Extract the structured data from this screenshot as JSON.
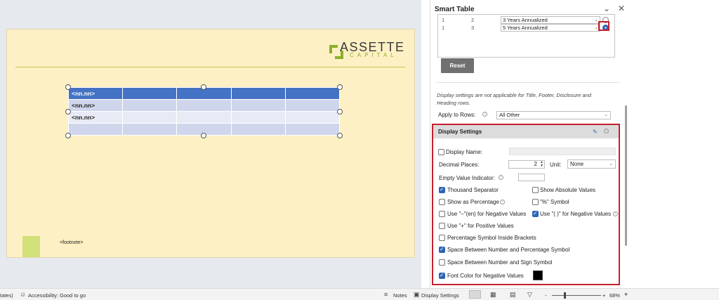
{
  "slide": {
    "logo_name": "ASSETTE",
    "logo_sub": "CAPITAL",
    "table_rows": [
      [
        "<nn.nn>",
        "",
        "",
        "",
        ""
      ],
      [
        "<nn.nn>",
        "",
        "",
        "",
        ""
      ],
      [
        "<nn.nn>",
        "",
        "",
        "",
        ""
      ],
      [
        "",
        "",
        "",
        "",
        ""
      ]
    ],
    "footnote": "<footnote>"
  },
  "pane": {
    "title": "Smart Table",
    "collapse_icon": "chevron-down-icon",
    "close_icon": "close-icon",
    "periods": [
      {
        "c1": "1",
        "c2": "2",
        "value": "3 Years Annualized",
        "selected": false
      },
      {
        "c1": "1",
        "c2": "3",
        "value": "5 Years Annualized",
        "selected": true
      }
    ],
    "reset_label": "Reset",
    "note": "Display settings are not applicable for Title, Footer, Disclosure and Heading rows.",
    "apply_label": "Apply to Rows:",
    "apply_value": "All Other"
  },
  "display_settings": {
    "title": "Display Settings",
    "display_name_label": "Display Name:",
    "decimal_label": "Decimal Places:",
    "decimal_value": "2",
    "unit_label": "Unit:",
    "unit_value": "None",
    "empty_label": "Empty Value Indicator:",
    "options": {
      "thousand_sep": "Thousand Separator",
      "show_absolute": "Show Absolute Values",
      "show_pct": "Show as Percentage",
      "pct_symbol": "\"%\" Symbol",
      "use_en": "Use \"–\"(en) for Negative Values",
      "use_paren": "Use \"( )\" for Negative Values",
      "use_plus": "Use \"+\" for Positive Values",
      "pct_brackets": "Percentage Symbol Inside Brackets",
      "space_pct": "Space Between Number and Percentage Symbol",
      "space_sign": "Space Between Number and Sign Symbol",
      "font_color_neg": "Font Color for Negative Values"
    },
    "negative_color": "#000000"
  },
  "statusbar": {
    "left_text": "tates)",
    "accessibility": "Accessibility: Good to go",
    "notes": "Notes",
    "display_settings": "Display Settings",
    "zoom_minus": "-",
    "zoom_plus": "+",
    "zoom": "68%"
  },
  "colors": {
    "accent_red": "#c5202f",
    "check_blue": "#2f64b5",
    "table_header": "#4472c4",
    "slide_bg": "#fdf0c4"
  }
}
